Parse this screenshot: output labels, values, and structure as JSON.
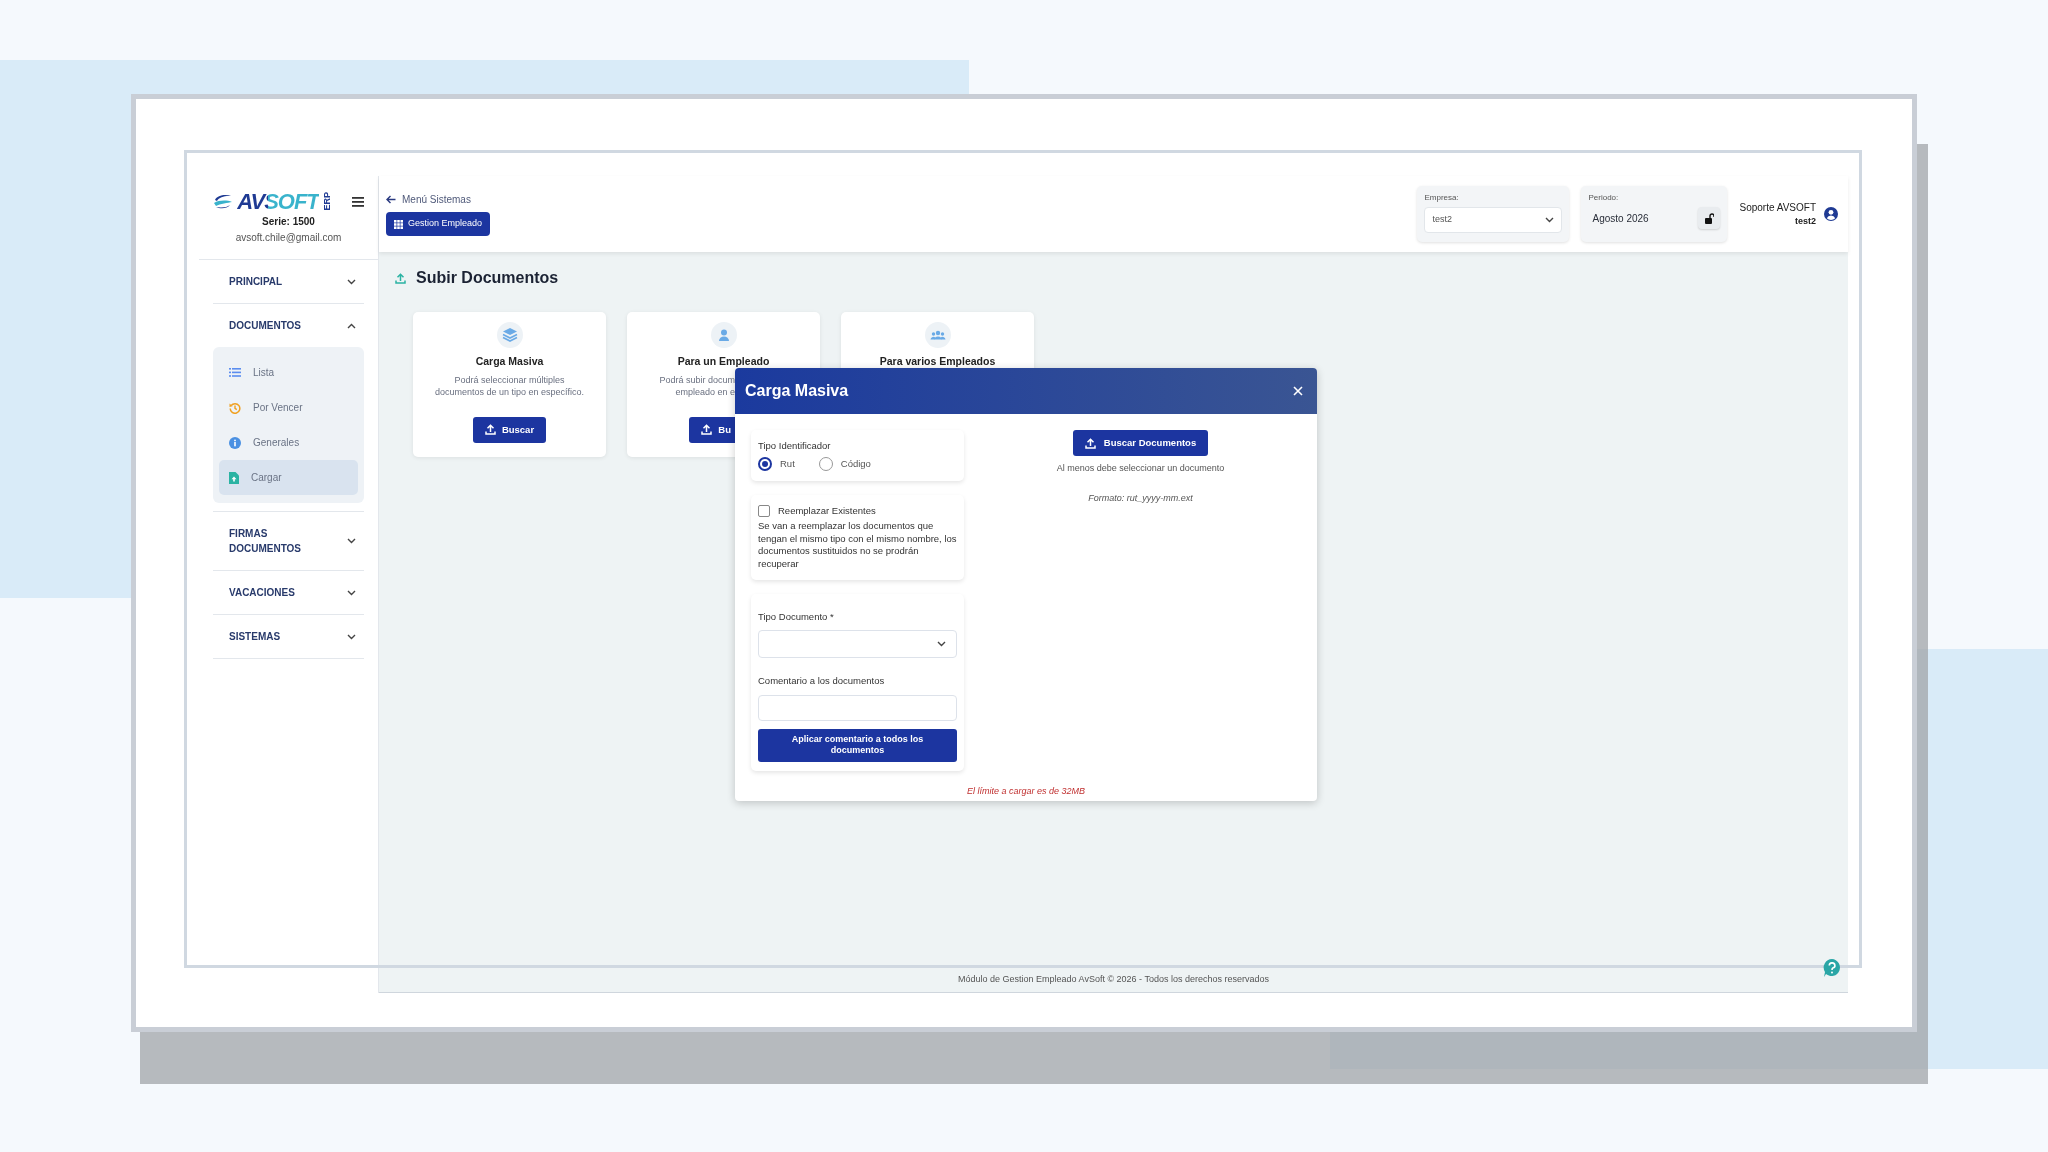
{
  "sidebar": {
    "logo": "AVSOFT",
    "logo_tag": "ERP",
    "serie": "Serie: 1500",
    "email": "avsoft.chile@gmail.com",
    "sections": [
      {
        "label": "PRINCIPAL",
        "expanded": false
      },
      {
        "label": "DOCUMENTOS",
        "expanded": true,
        "items": [
          {
            "label": "Lista",
            "selected": false
          },
          {
            "label": "Por Vencer",
            "selected": false
          },
          {
            "label": "Generales",
            "selected": false
          },
          {
            "label": "Cargar",
            "selected": true
          }
        ]
      },
      {
        "label": "FIRMAS DOCUMENTOS",
        "expanded": false
      },
      {
        "label": "VACACIONES",
        "expanded": false
      },
      {
        "label": "SISTEMAS",
        "expanded": false
      }
    ]
  },
  "header": {
    "back_link": "Menú Sistemas",
    "module_button": "Gestion Empleado",
    "empresa": {
      "label": "Empresa:",
      "value": "test2"
    },
    "periodo": {
      "label": "Periodo:",
      "value": "Agosto 2026"
    },
    "user": {
      "name": "Soporte AVSOFT",
      "company": "test2"
    }
  },
  "page_title": "Subir Documentos",
  "cards": [
    {
      "title": "Carga Masiva",
      "description": "Podrá seleccionar múltiples documentos de un tipo en específico.",
      "button": "Buscar",
      "covered": false
    },
    {
      "title": "Para un Empleado",
      "description": "Podrá subir docum\nempleado en e",
      "button": "Bu",
      "covered": true
    },
    {
      "title": "Para varios Empleados"
    }
  ],
  "modal": {
    "title": "Carga Masiva",
    "tipo_identificador": {
      "label": "Tipo Identificador",
      "options": [
        {
          "label": "Rut",
          "selected": true
        },
        {
          "label": "Código",
          "selected": false
        }
      ]
    },
    "reemplazar": {
      "label": "Reemplazar Existentes",
      "checked": false,
      "description": "Se van a reemplazar los documentos que tengan el mismo tipo con el mismo nombre, los documentos sustituidos no se prodrán recuperar"
    },
    "tipo_documento": {
      "label": "Tipo Documento *"
    },
    "comentario": {
      "label": "Comentario a los documentos"
    },
    "apply_button": "Aplicar comentario a todos los documentos",
    "search_button": "Buscar Documentos",
    "hint": "Al menos debe seleccionar un documento",
    "format": "Formato: rut_yyyy-mm.ext",
    "limit": "El límite a cargar es de 32MB"
  },
  "footer": "Módulo de Gestion Empleado AvSoft © 2026 - Todos los derechos reservados"
}
